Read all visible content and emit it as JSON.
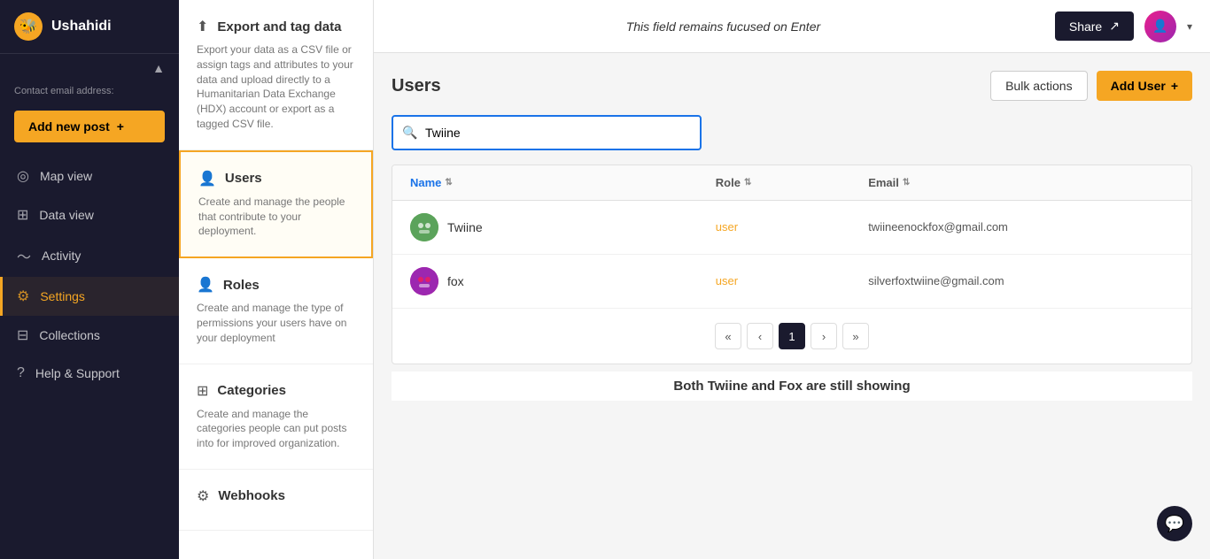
{
  "app": {
    "name": "Ushahidi",
    "logo_emoji": "🐝"
  },
  "topbar": {
    "center_text": "This field remains fucused on Enter",
    "share_label": "Share",
    "chevron": "▾"
  },
  "sidebar": {
    "contact_label": "Contact email address:",
    "add_post_label": "Add new post",
    "add_post_icon": "+",
    "items": [
      {
        "id": "map-view",
        "label": "Map view",
        "icon": "◎"
      },
      {
        "id": "data-view",
        "label": "Data view",
        "icon": "⊞"
      },
      {
        "id": "activity",
        "label": "Activity",
        "icon": "〜"
      },
      {
        "id": "settings",
        "label": "Settings",
        "icon": "⚙"
      },
      {
        "id": "collections",
        "label": "Collections",
        "icon": "⊟"
      },
      {
        "id": "help-support",
        "label": "Help & Support",
        "icon": "?"
      }
    ]
  },
  "middle_panel": {
    "items": [
      {
        "id": "export",
        "icon": "⬆",
        "title": "Export and tag data",
        "desc": "Export your data as a CSV file or assign tags and attributes to your data and upload directly to a Humanitarian Data Exchange (HDX) account or export as a tagged CSV file."
      },
      {
        "id": "users",
        "icon": "👤",
        "title": "Users",
        "desc": "Create and manage the people that contribute to your deployment."
      },
      {
        "id": "roles",
        "icon": "👤",
        "title": "Roles",
        "desc": "Create and manage the type of permissions your users have on your deployment"
      },
      {
        "id": "categories",
        "icon": "⊞",
        "title": "Categories",
        "desc": "Create and manage the categories people can put posts into for improved organization."
      },
      {
        "id": "webhooks",
        "icon": "⚙",
        "title": "Webhooks",
        "desc": ""
      }
    ]
  },
  "users_panel": {
    "title": "Users",
    "bulk_actions_label": "Bulk actions",
    "add_user_label": "Add User",
    "add_user_icon": "+",
    "search_placeholder": "Twiine",
    "search_value": "Twiine",
    "table": {
      "columns": [
        {
          "id": "name",
          "label": "Name",
          "active": true
        },
        {
          "id": "role",
          "label": "Role",
          "active": false
        },
        {
          "id": "email",
          "label": "Email",
          "active": false
        }
      ],
      "rows": [
        {
          "id": "twiine",
          "name": "Twiine",
          "role": "user",
          "email": "twiineenockfox@gmail.com",
          "avatar_class": "avatar-twiine",
          "avatar_emoji": "🔵"
        },
        {
          "id": "fox",
          "name": "fox",
          "role": "user",
          "email": "silverfoxtwiine@gmail.com",
          "avatar_class": "avatar-fox",
          "avatar_emoji": "🟣"
        }
      ]
    },
    "pagination": {
      "first": "«",
      "prev": "‹",
      "current": "1",
      "next": "›",
      "last": "»"
    },
    "annotation_caption": "Both Twiine and Fox are still showing"
  }
}
